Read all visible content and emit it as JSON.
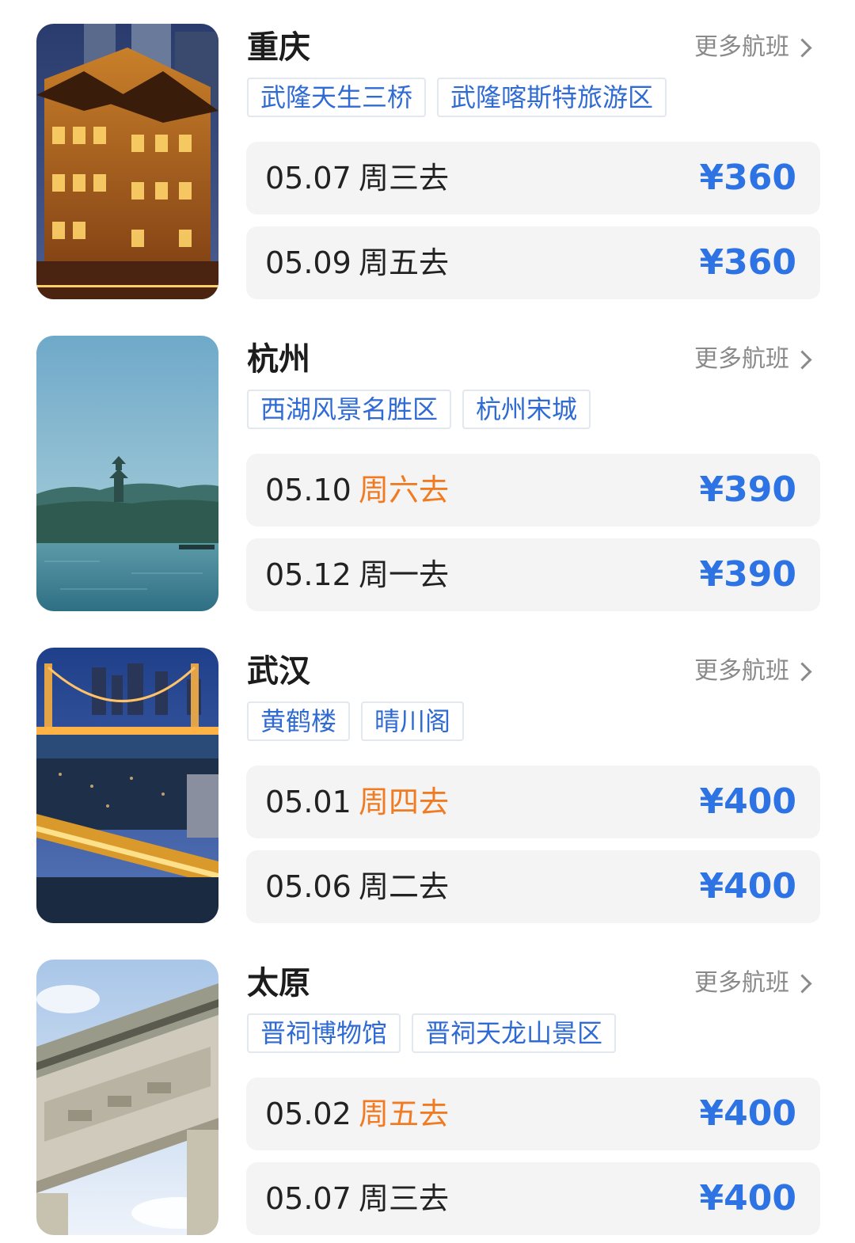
{
  "more_label": "更多航班",
  "colors": {
    "price": "#2d73e3",
    "weekend_day": "#f07b22",
    "tag_text": "#2f6bd3",
    "flight_row_bg": "#f4f4f5"
  },
  "destinations": [
    {
      "city": "重庆",
      "image": "chongqing-night-building-photo",
      "tags": [
        "武隆天生三桥",
        "武隆喀斯特旅游区"
      ],
      "flights": [
        {
          "date": "05.07",
          "day": "周三去",
          "highlight": false,
          "price": "¥360"
        },
        {
          "date": "05.09",
          "day": "周五去",
          "highlight": false,
          "price": "¥360"
        }
      ]
    },
    {
      "city": "杭州",
      "image": "hangzhou-west-lake-pagoda-photo",
      "tags": [
        "西湖风景名胜区",
        "杭州宋城"
      ],
      "flights": [
        {
          "date": "05.10",
          "day": "周六去",
          "highlight": true,
          "price": "¥390"
        },
        {
          "date": "05.12",
          "day": "周一去",
          "highlight": false,
          "price": "¥390"
        }
      ]
    },
    {
      "city": "武汉",
      "image": "wuhan-bridge-night-photo",
      "tags": [
        "黄鹤楼",
        "晴川阁"
      ],
      "flights": [
        {
          "date": "05.01",
          "day": "周四去",
          "highlight": true,
          "price": "¥400"
        },
        {
          "date": "05.06",
          "day": "周二去",
          "highlight": false,
          "price": "¥400"
        }
      ]
    },
    {
      "city": "太原",
      "image": "taiyuan-stone-archway-photo",
      "tags": [
        "晋祠博物馆",
        "晋祠天龙山景区"
      ],
      "flights": [
        {
          "date": "05.02",
          "day": "周五去",
          "highlight": true,
          "price": "¥400"
        },
        {
          "date": "05.07",
          "day": "周三去",
          "highlight": false,
          "price": "¥400"
        }
      ]
    }
  ]
}
